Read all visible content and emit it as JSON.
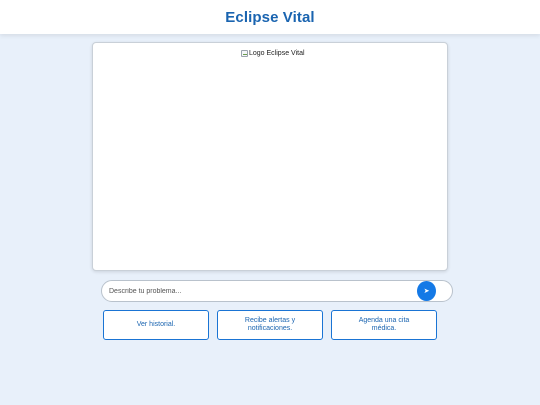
{
  "header": {
    "title": "Eclipse Vital"
  },
  "chat": {
    "logo_alt": "Logo Eclipse Vital"
  },
  "input": {
    "placeholder": "Describe tu problema...",
    "send_icon": "➤"
  },
  "actions": [
    {
      "label": "Ver historial."
    },
    {
      "label": "Recibe alertas y notificaciones."
    },
    {
      "label": "Agenda una cita médica."
    }
  ],
  "colors": {
    "brand": "#1a64b0",
    "accent": "#1479e6",
    "background": "#e8f0fa"
  }
}
